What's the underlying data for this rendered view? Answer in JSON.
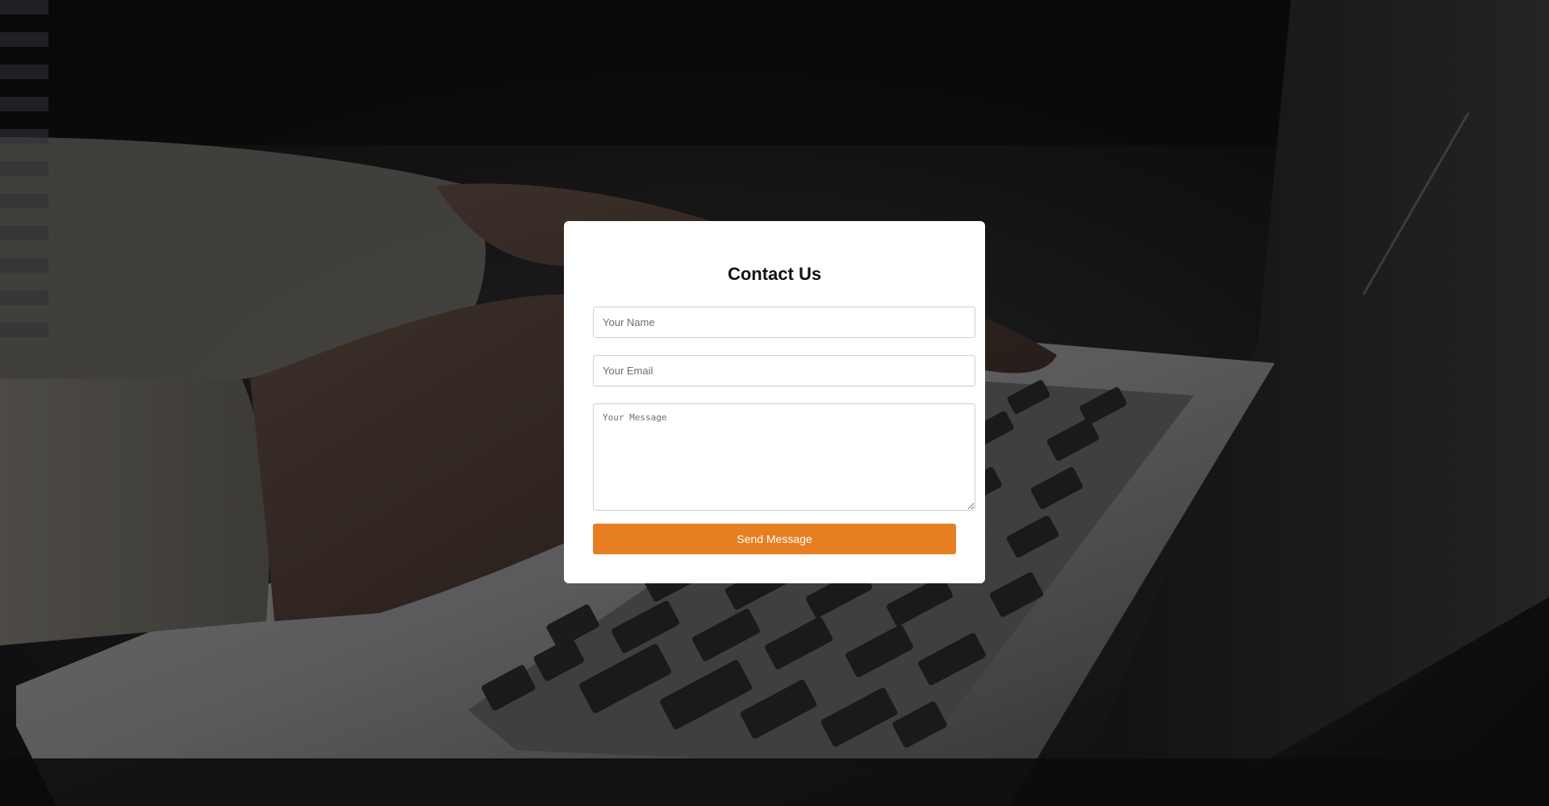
{
  "contact_form": {
    "title": "Contact Us",
    "name_placeholder": "Your Name",
    "email_placeholder": "Your Email",
    "message_placeholder": "Your Message",
    "submit_label": "Send Message"
  },
  "colors": {
    "accent": "#e67e22",
    "card_background": "#ffffff",
    "page_background": "#0d0d0e"
  },
  "background_image": {
    "subject": "hands-typing-on-laptop"
  }
}
